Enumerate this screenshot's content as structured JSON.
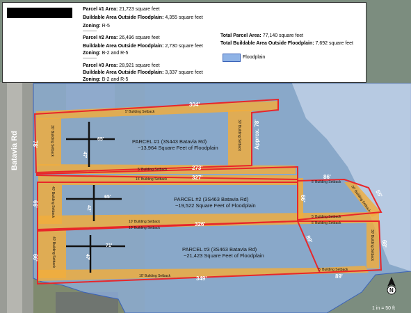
{
  "legend": {
    "p1_area_label": "Parcel #1 Area:",
    "p1_area_value": "21,723 square feet",
    "p1_build_label": "Buildable Area Outside Floodplain:",
    "p1_build_value": "4,355 square feet",
    "p1_zone_label": "Zoning:",
    "p1_zone_value": "R-5",
    "separator": "----------",
    "p2_area_label": "Parcel #2 Area:",
    "p2_area_value": "26,496 square feet",
    "p2_build_label": "Buildable Area Outside Floodplain:",
    "p2_build_value": "2,730 square feet",
    "p2_zone_label": "Zoning:",
    "p2_zone_value": "B-2 and R-5",
    "p3_area_label": "Parcel #3 Area:",
    "p3_area_value": "28,921 square feet",
    "p3_build_label": "Buildable Area Outside Floodplain:",
    "p3_build_value": "3,337 square feet",
    "p3_zone_label": "Zoning:",
    "p3_zone_value": "B-2 and R-5",
    "total_area_label": "Total Parcel Area:",
    "total_area_value": "77,140 square feet",
    "total_build_label": "Total Buildable Area Outside Floodplain:",
    "total_build_value": "7,692 square feet",
    "floodplain_label": "Floodplain"
  },
  "colors": {
    "parcel_outline": "#e8262a",
    "setback_fill": "#f1ad3c",
    "floodplain_fill": "#8fb3e6",
    "floodplain_outline": "#3a62b8"
  },
  "map": {
    "road_label": "Batavia Rd",
    "approx_label": "Approx. 78'",
    "parcel1_title": "PARCEL #1 (3S443 Batavia Rd)",
    "parcel1_sub": "~13,964 Square Feet of Floodplain",
    "parcel2_title": "PARCEL #2 (3S463 Batavia Rd)",
    "parcel2_sub": "~19,522 Square Feet of Floodplain",
    "parcel3_title": "PARCEL #3 (3S463 Batavia Rd)",
    "parcel3_sub": "~21,423 Square Feet of Floodplain",
    "setback_5": "5' Building Setback",
    "setback_10": "10' Building Setback",
    "setback_15": "15' Building Setback",
    "setback_30": "30' Building Setback",
    "setback_40": "40' Building Setback",
    "dim_304": "304'",
    "dim_273": "273'",
    "dim_327": "327'",
    "dim_326": "326'",
    "dim_349": "349'",
    "dim_78": "78'",
    "dim_66a": "66'",
    "dim_66b": "66'",
    "dim_66c": "66'",
    "dim_65a": "65'",
    "dim_65b": "65'",
    "dim_71": "71'",
    "dim_47": "47'",
    "dim_42": "42'",
    "dim_47b": "47'",
    "dim_86": "86'",
    "dim_55": "55'",
    "dim_89a": "89'",
    "dim_89b": "89'",
    "dim_68": "68'",
    "north_label": "N",
    "scale_label": "1 in = 50 ft"
  }
}
